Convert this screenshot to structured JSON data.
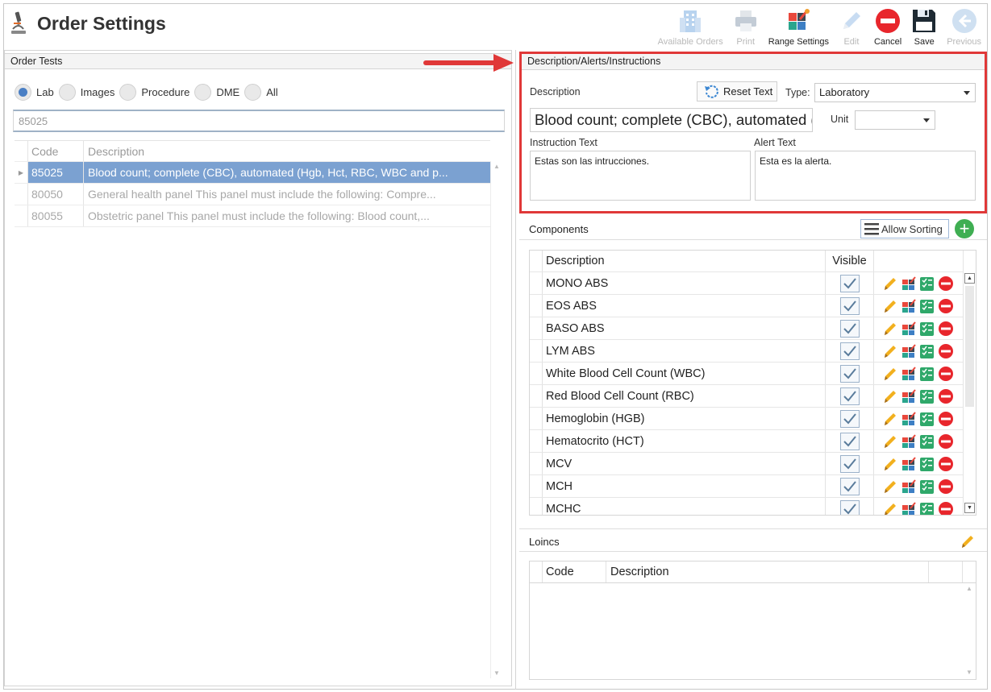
{
  "header": {
    "title": "Order Settings"
  },
  "toolbar": [
    {
      "label": "Available Orders",
      "icon": "building-icon",
      "enabled": false
    },
    {
      "label": "Print",
      "icon": "printer-icon",
      "enabled": false
    },
    {
      "label": "Range Settings",
      "icon": "range-settings-icon",
      "enabled": true
    },
    {
      "label": "Edit",
      "icon": "pencil-icon",
      "enabled": false
    },
    {
      "label": "Cancel",
      "icon": "cancel-icon",
      "enabled": true
    },
    {
      "label": "Save",
      "icon": "floppy-icon",
      "enabled": true
    },
    {
      "label": "Previous",
      "icon": "back-arrow-icon",
      "enabled": false
    }
  ],
  "left": {
    "section_title": "Order Tests",
    "radios": [
      {
        "label": "Lab",
        "checked": true
      },
      {
        "label": "Images",
        "checked": false
      },
      {
        "label": "Procedure",
        "checked": false
      },
      {
        "label": "DME",
        "checked": false
      },
      {
        "label": "All",
        "checked": false
      }
    ],
    "search_value": "85025",
    "columns": {
      "code": "Code",
      "description": "Description"
    },
    "rows": [
      {
        "code": "85025",
        "description": "Blood count; complete (CBC), automated (Hgb, Hct, RBC, WBC and p...",
        "selected": true
      },
      {
        "code": "80050",
        "description": "General health panel This panel must include the following: Compre...",
        "selected": false
      },
      {
        "code": "80055",
        "description": "Obstetric panel This panel must include the following: Blood count,...",
        "selected": false
      }
    ]
  },
  "details": {
    "section_title": "Description/Alerts/Instructions",
    "description_label": "Description",
    "reset_text_label": "Reset Text",
    "type_label": "Type:",
    "type_value": "Laboratory",
    "description_value": "Blood count; complete (CBC), automated (H",
    "unit_label": "Unit",
    "unit_value": "",
    "instruction_label": "Instruction Text",
    "instruction_value": "Estas son las intrucciones.",
    "alert_label": "Alert Text",
    "alert_value": "Esta es la alerta."
  },
  "components": {
    "section_title": "Components",
    "allow_sorting_label": "Allow Sorting",
    "columns": {
      "description": "Description",
      "visible": "Visible"
    },
    "rows": [
      {
        "description": "MONO ABS",
        "visible": true
      },
      {
        "description": "EOS ABS",
        "visible": true
      },
      {
        "description": "BASO ABS",
        "visible": true
      },
      {
        "description": "LYM ABS",
        "visible": true
      },
      {
        "description": "White Blood Cell Count (WBC)",
        "visible": true
      },
      {
        "description": "Red Blood Cell Count (RBC)",
        "visible": true
      },
      {
        "description": "Hemoglobin (HGB)",
        "visible": true
      },
      {
        "description": "Hematocrito (HCT)",
        "visible": true
      },
      {
        "description": "MCV",
        "visible": true
      },
      {
        "description": "MCH",
        "visible": true
      },
      {
        "description": "MCHC",
        "visible": true
      }
    ]
  },
  "loincs": {
    "section_title": "Loincs",
    "columns": {
      "code": "Code",
      "description": "Description"
    }
  },
  "colors": {
    "accent": "#4a7fc4",
    "selected_row": "#7ba1d1",
    "highlight": "#e03838",
    "add": "#3fae52",
    "cancel": "#e8262c"
  }
}
